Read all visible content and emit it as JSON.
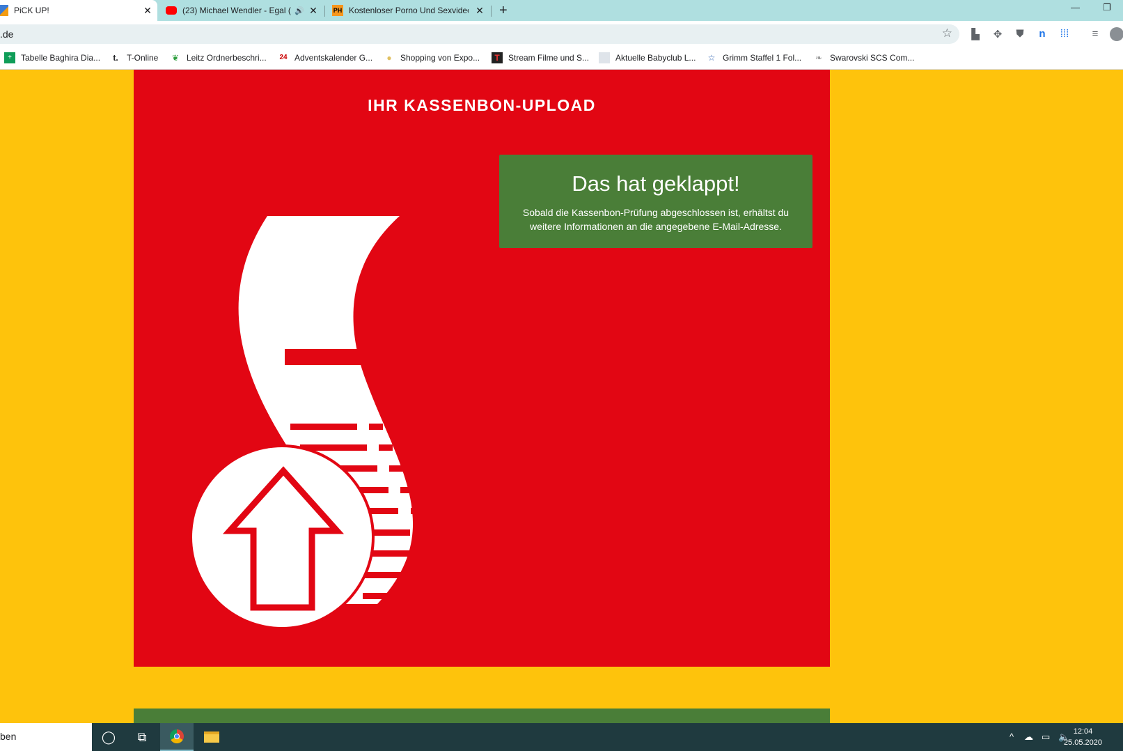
{
  "browser": {
    "tabs": [
      {
        "title": "PiCK UP!",
        "active": true
      },
      {
        "title": "(23) Michael Wendler - Egal (",
        "active": false
      },
      {
        "title": "Kostenloser Porno Und Sexvideo",
        "active": false
      }
    ],
    "new_tab": "+",
    "window_controls": {
      "minimize": "—",
      "restore": "❐"
    },
    "address": {
      "url": ".de"
    },
    "bookmarks": [
      "Tabelle Baghira Dia...",
      "T-Online",
      "Leitz Ordnerbeschri...",
      "Adventskalender G...",
      "Shopping von Expo...",
      "Stream Filme und S...",
      "Aktuelle Babyclub L...",
      "Grimm Staffel 1 Fol...",
      "Swarovski SCS Com..."
    ]
  },
  "page": {
    "heading": "IHR KASSENBON-UPLOAD",
    "success_title": "Das hat geklappt!",
    "success_text": "Sobald die Kassenbon-Prüfung abgeschlossen ist, erhältst du weitere Informationen an die angegebene E-Mail-Adresse."
  },
  "taskbar": {
    "search_text": "ben",
    "time": "12:04",
    "date": "25.05.2020"
  },
  "colors": {
    "page_bg": "#fec30c",
    "panel_red": "#e20613",
    "success_green": "#4a7e38"
  }
}
